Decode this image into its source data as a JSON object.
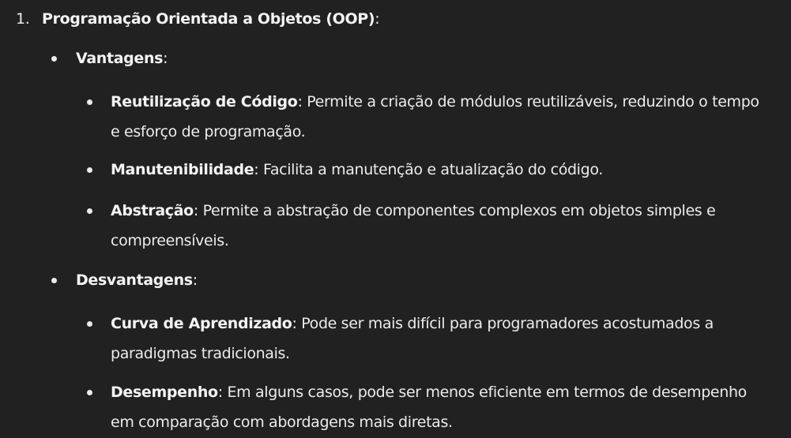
{
  "list": {
    "number": "1.",
    "title": "Programação Orientada a Objetos (OOP)",
    "title_suffix": ":",
    "sections": [
      {
        "heading": "Vantagens",
        "heading_suffix": ":",
        "items": [
          {
            "term": "Reutilização de Código",
            "lines": [
              ": Permite a criação de módulos reutilizáveis, reduzindo o tempo",
              "e esforço de programação."
            ]
          },
          {
            "term": "Manutenibilidade",
            "lines": [
              ": Facilita a manutenção e atualização do código."
            ]
          },
          {
            "term": "Abstração",
            "lines": [
              ": Permite a abstração de componentes complexos em objetos simples e",
              "compreensíveis."
            ]
          }
        ]
      },
      {
        "heading": "Desvantagens",
        "heading_suffix": ":",
        "items": [
          {
            "term": "Curva de Aprendizado",
            "lines": [
              ": Pode ser mais difícil para programadores acostumados a",
              "paradigmas tradicionais."
            ]
          },
          {
            "term": "Desempenho",
            "lines": [
              ": Em alguns casos, pode ser menos eficiente em termos de desempenho",
              "em comparação com abordagens mais diretas."
            ]
          }
        ]
      }
    ]
  }
}
